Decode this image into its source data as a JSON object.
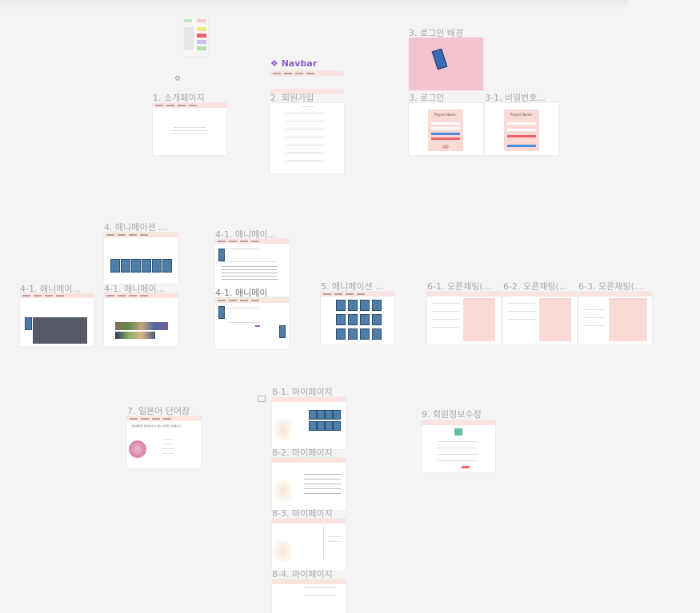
{
  "component": {
    "title": "Navbar"
  },
  "frames": {
    "intro": "1. 소개페이지",
    "signup": "2. 회원가입",
    "login_bg": "3. 로그인 배경",
    "login": "3. 로그인",
    "password": "3-1. 비밀번호...",
    "anim": "4. 애니메이션 ...",
    "anim_41a": "4-1. 애니메이...",
    "anim_41b": "4-1. 애니메이...",
    "anim_41c": "4-1. 애니메이...",
    "anim_41d": "4-1. 애니메이",
    "anim5": "5. 애니메이션 ...",
    "chat61": "6-1. 오픈채팅(...",
    "chat62": "6-2. 오픈채팅(...",
    "chat63": "6-3. 오픈채팅(...",
    "vocab": "7. 일본어 단어장",
    "mypage1": "8-1. 마이페이지",
    "mypage2": "8-2. 마이페이지",
    "mypage3": "8-3. 마이페이지",
    "mypage4": "8-4. 마이페이지",
    "profile": "9. 회원정보수정"
  },
  "content": {
    "vocab_heading": "애니메이션 단어를 볼 수 있는 단어장 단어입니다",
    "login_project": "Project Name",
    "password_project": "Project Name"
  },
  "colors": {
    "nav": "#fbe3df",
    "login_bg": "#f2c4d0",
    "accent_purple": "#8a5bd6"
  }
}
